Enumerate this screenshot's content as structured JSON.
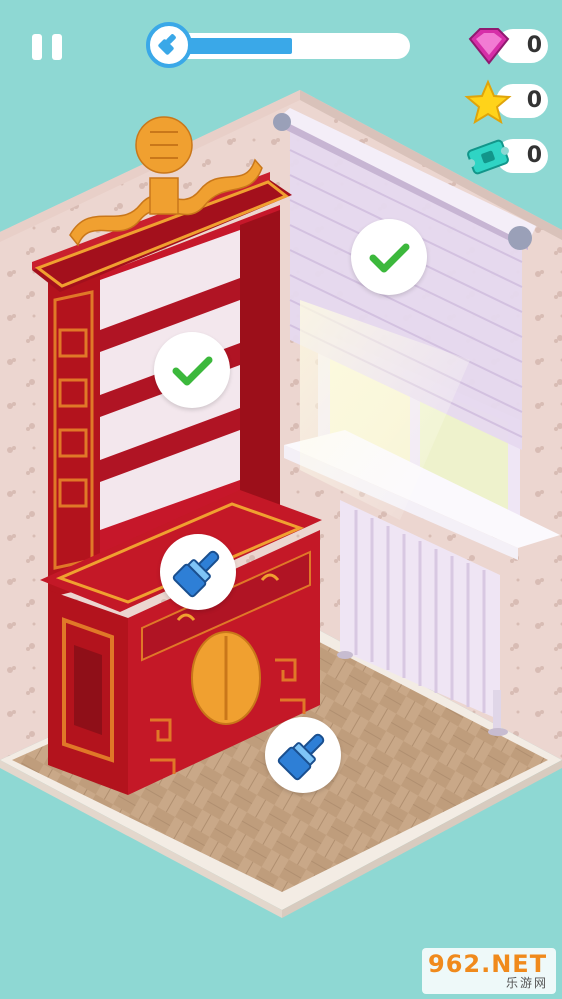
{
  "hud": {
    "progress": 0.45,
    "gems": "0",
    "stars": "0",
    "tickets": "0"
  },
  "scene": {
    "items": [
      {
        "name": "window-blind",
        "status": "done"
      },
      {
        "name": "bookshelf",
        "status": "done"
      },
      {
        "name": "cabinet",
        "status": "paint"
      },
      {
        "name": "floor",
        "status": "paint"
      }
    ]
  },
  "watermark": {
    "main": "962.NET",
    "sub": "乐游网"
  },
  "colors": {
    "background": "#8ed8d3",
    "accent_blue": "#3aa8e8",
    "check_green": "#3cb83c",
    "furniture_red": "#b3131d",
    "gold": "#f0a030"
  }
}
